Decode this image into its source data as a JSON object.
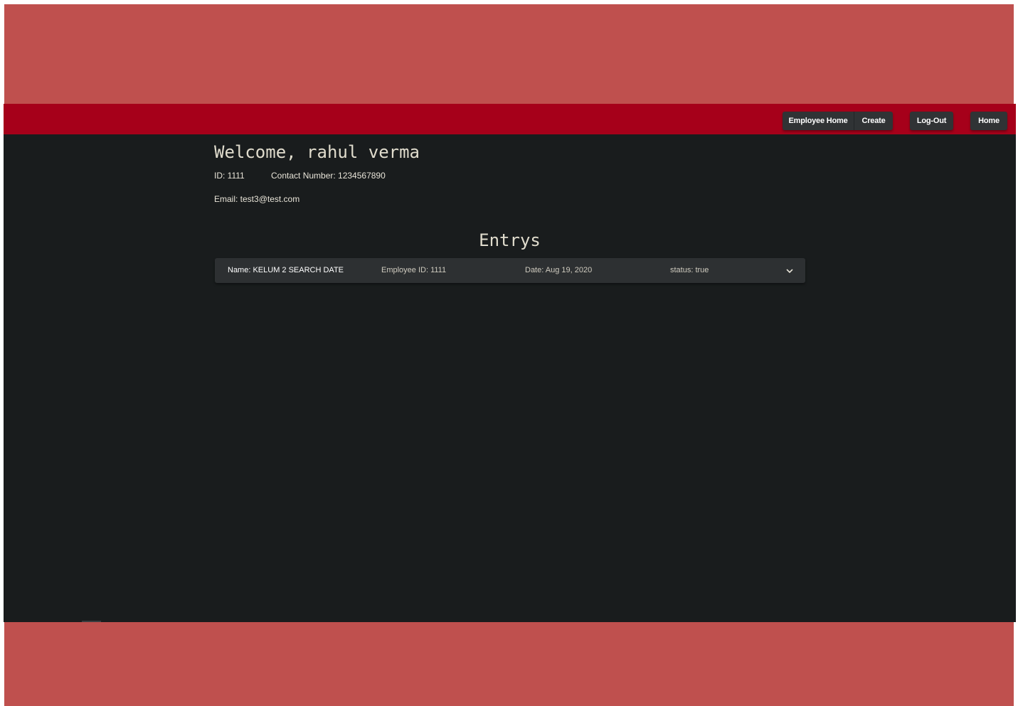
{
  "nav": {
    "employee_home": "Employee Home",
    "create": "Create",
    "logout": "Log-Out",
    "home": "Home"
  },
  "profile": {
    "welcome": "Welcome, rahul verma",
    "id": "ID: 1111",
    "contact": "Contact Number: 1234567890",
    "email": "Email: test3@test.com"
  },
  "entries": {
    "heading": "Entrys",
    "items": [
      {
        "name": "Name: KELUM 2 SEARCH DATE",
        "employee_id": "Employee ID: 1111",
        "date": "Date: Aug 19, 2020",
        "status": "status: true",
        "expand_icon": "chevron-down-icon"
      }
    ]
  },
  "colors": {
    "navbar": "#a6001a",
    "background": "#191c1d",
    "frame": "#bf504e",
    "button": "#303335",
    "card": "#2d3032"
  }
}
